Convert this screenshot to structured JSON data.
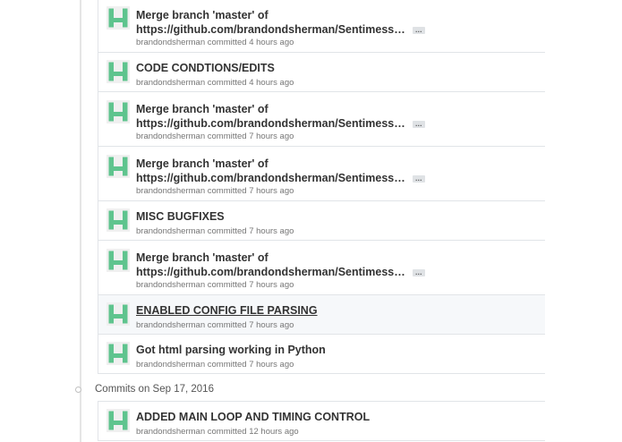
{
  "colors": {
    "avatar_green": "#5fc48e",
    "title_text": "#333333",
    "meta_text": "#767676",
    "border": "#e1e4e8",
    "hover_row": "#f6f8fa"
  },
  "icons": {
    "avatar": "identicon-avatar-icon",
    "ellipsis": "ellipsis-expand-icon",
    "timeline_dot": "commit-group-dot-icon"
  },
  "commits_top": [
    {
      "title_line1": "Merge branch 'master' of",
      "title_line2": "https://github.com/brandondsherman/Sentimess…",
      "ellipsis": "…",
      "meta": "brandondsherman committed 4 hours ago"
    },
    {
      "title_line1": "CODE CONDTIONS/EDITS",
      "meta": "brandondsherman committed 4 hours ago"
    },
    {
      "title_line1": "Merge branch 'master' of",
      "title_line2": "https://github.com/brandondsherman/Sentimess…",
      "ellipsis": "…",
      "meta": "brandondsherman committed 7 hours ago"
    },
    {
      "title_line1": "Merge branch 'master' of",
      "title_line2": "https://github.com/brandondsherman/Sentimess…",
      "ellipsis": "…",
      "meta": "brandondsherman committed 7 hours ago"
    },
    {
      "title_line1": "MISC BUGFIXES",
      "meta": "brandondsherman committed 7 hours ago"
    },
    {
      "title_line1": "Merge branch 'master' of",
      "title_line2": "https://github.com/brandondsherman/Sentimess…",
      "ellipsis": "…",
      "meta": "brandondsherman committed 7 hours ago"
    },
    {
      "title_line1": "ENABLED CONFIG FILE PARSING",
      "meta": "brandondsherman committed 7 hours ago"
    },
    {
      "title_line1": "Got html parsing working in Python",
      "meta": "brandondsherman committed 7 hours ago"
    }
  ],
  "day_group": {
    "label": "Commits on Sep 17, 2016"
  },
  "commits_bottom": [
    {
      "title_line1": "ADDED MAIN LOOP AND TIMING CONTROL",
      "meta": "brandondsherman committed 12 hours ago"
    }
  ]
}
